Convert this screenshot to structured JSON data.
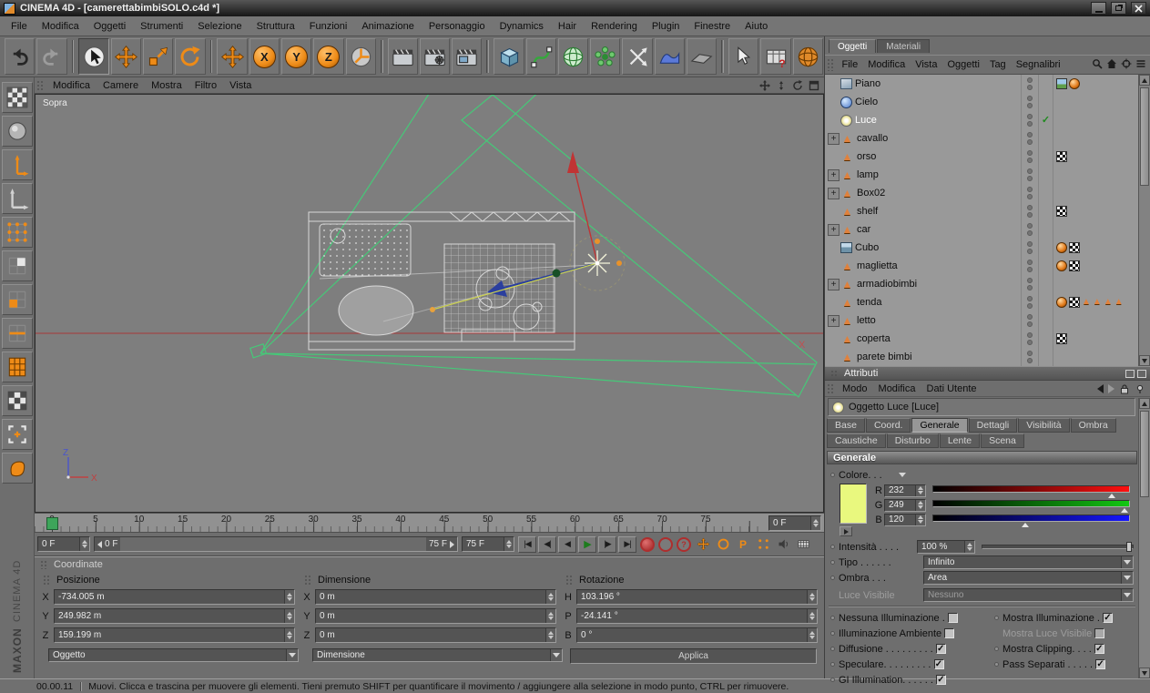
{
  "window": {
    "title": "CINEMA 4D - [camerettabimbiSOLO.c4d *]"
  },
  "menubar": {
    "items": [
      "File",
      "Modifica",
      "Oggetti",
      "Strumenti",
      "Selezione",
      "Struttura",
      "Funzioni",
      "Animazione",
      "Personaggio",
      "Dynamics",
      "Hair",
      "Rendering",
      "Plugin",
      "Finestre",
      "Aiuto"
    ]
  },
  "toolbar": {
    "axis_locks": [
      "X",
      "Y",
      "Z"
    ]
  },
  "icons": {
    "question_mark": "?"
  },
  "viewport": {
    "menu": [
      "Modifica",
      "Camere",
      "Mostra",
      "Filtro",
      "Vista"
    ],
    "view_label": "Sopra",
    "axis_x_label": "X",
    "gizmo": {
      "z": "Z",
      "x": "X"
    }
  },
  "objects_panel": {
    "tabs": [
      {
        "label": "Oggetti",
        "active": true
      },
      {
        "label": "Materiali",
        "active": false
      }
    ],
    "menu": [
      "File",
      "Modifica",
      "Vista",
      "Oggetti",
      "Tag",
      "Segnalibri"
    ],
    "items": [
      {
        "label": "Piano",
        "icon": "plane",
        "tags": [
          "paint",
          "sphere"
        ]
      },
      {
        "label": "Cielo",
        "icon": "sky"
      },
      {
        "label": "Luce",
        "icon": "light",
        "selected": true,
        "check": true
      },
      {
        "label": "cavallo",
        "icon": "triangle",
        "expandable": true
      },
      {
        "label": "orso",
        "icon": "triangle",
        "tags": [
          "checker"
        ]
      },
      {
        "label": "lamp",
        "icon": "triangle",
        "expandable": true
      },
      {
        "label": "Box02",
        "icon": "triangle",
        "expandable": true
      },
      {
        "label": "shelf",
        "icon": "triangle",
        "tags": [
          "checker"
        ]
      },
      {
        "label": "car",
        "icon": "triangle",
        "expandable": true
      },
      {
        "label": "Cubo",
        "icon": "cube",
        "tags": [
          "sphere",
          "checker"
        ]
      },
      {
        "label": "maglietta",
        "icon": "triangle",
        "tags": [
          "sphere",
          "checker"
        ]
      },
      {
        "label": "armadiobimbi",
        "icon": "triangle",
        "expandable": true
      },
      {
        "label": "tenda",
        "icon": "triangle",
        "tags": [
          "sphere",
          "checker",
          "tri",
          "tri",
          "tri",
          "tri"
        ]
      },
      {
        "label": "letto",
        "icon": "triangle",
        "expandable": true
      },
      {
        "label": "coperta",
        "icon": "triangle",
        "tags": [
          "checker"
        ]
      },
      {
        "label": "parete bimbi",
        "icon": "triangle"
      }
    ]
  },
  "attributes_panel": {
    "header": "Attributi",
    "menu": [
      "Modo",
      "Modifica",
      "Dati Utente"
    ],
    "object_title": "Oggetto Luce [Luce]",
    "tabs_row1": [
      "Base",
      "Coord.",
      "Generale",
      "Dettagli",
      "Visibilità",
      "Ombra"
    ],
    "tabs_row2": [
      "Caustiche",
      "Disturbo",
      "Lente",
      "Scena"
    ],
    "active_tab": "Generale",
    "section_title": "Generale",
    "color": {
      "label": "Colore. . .",
      "swatch": "#e9f87e",
      "channels": [
        {
          "label": "R",
          "value": "232",
          "max": 255,
          "color": "#ff1010"
        },
        {
          "label": "G",
          "value": "249",
          "max": 255,
          "color": "#12c812"
        },
        {
          "label": "B",
          "value": "120",
          "max": 255,
          "color": "#1515ff"
        }
      ]
    },
    "intensity": {
      "label": "Intensità . . . .",
      "value": "100 %"
    },
    "tipo": {
      "label": "Tipo . . . . . .",
      "value": "Infinito"
    },
    "ombra": {
      "label": "Ombra . . .",
      "value": "Area"
    },
    "luce_visibile": {
      "label": "Luce Visibile",
      "value": "Nessuno"
    },
    "options_rows": [
      {
        "left": {
          "label": "Nessuna Illuminazione .",
          "checked": false,
          "anim": true
        },
        "right": {
          "label": "Mostra Illuminazione .",
          "checked": true,
          "anim": true
        }
      },
      {
        "left": {
          "label": "Illuminazione Ambiente",
          "checked": false,
          "anim": true
        },
        "right": {
          "label": "Mostra Luce Visibile",
          "checked": false,
          "anim": false,
          "disabled": true
        }
      },
      {
        "left": {
          "label": "Diffusione . . . . . . . . .",
          "checked": true,
          "anim": true
        },
        "right": {
          "label": "Mostra Clipping. . . .",
          "checked": true,
          "anim": true
        }
      },
      {
        "left": {
          "label": "Speculare. . . . . . . . .",
          "checked": true,
          "anim": true
        },
        "right": {
          "label": "Pass Separati . . . . .",
          "checked": true,
          "anim": true
        }
      },
      {
        "left": {
          "label": "GI Illumination. . . . . .",
          "checked": true,
          "anim": true
        },
        "right": null
      }
    ]
  },
  "timeline": {
    "ticks": [
      "0",
      "5",
      "10",
      "15",
      "20",
      "25",
      "30",
      "35",
      "40",
      "45",
      "50",
      "55",
      "60",
      "65",
      "70",
      "75"
    ],
    "frame_field": "0 F",
    "current_frame_field": "0 F",
    "range_start": "0 F",
    "range_end": "75 F",
    "end_field": "75 F",
    "transport": [
      {
        "name": "goto-start",
        "glyph": "|◀"
      },
      {
        "name": "prev-key",
        "glyph": "◀|"
      },
      {
        "name": "prev-frame",
        "glyph": "◀"
      },
      {
        "name": "play",
        "glyph": "▶"
      },
      {
        "name": "next-frame",
        "glyph": "|▶"
      },
      {
        "name": "goto-end",
        "glyph": "▶|"
      }
    ],
    "record_parameter_label": "P"
  },
  "coordinates": {
    "panel_title": "Coordinate",
    "groups": [
      {
        "title": "Posizione",
        "rows": [
          {
            "axis": "X",
            "value": "-734.005 m"
          },
          {
            "axis": "Y",
            "value": "249.982 m"
          },
          {
            "axis": "Z",
            "value": "159.199 m"
          }
        ]
      },
      {
        "title": "Dimensione",
        "rows": [
          {
            "axis": "X",
            "value": "0 m"
          },
          {
            "axis": "Y",
            "value": "0 m"
          },
          {
            "axis": "Z",
            "value": "0 m"
          }
        ]
      },
      {
        "title": "Rotazione",
        "rows": [
          {
            "axis": "H",
            "value": "103.196 °"
          },
          {
            "axis": "P",
            "value": "-24.141 °"
          },
          {
            "axis": "B",
            "value": "0 °"
          }
        ]
      }
    ],
    "dropdown_left": "Oggetto",
    "dropdown_mid": "Dimensione",
    "apply_button": "Applica"
  },
  "statusbar": {
    "time": "00.00.11",
    "message": "Muovi. Clicca e trascina per muovere gli elementi. Tieni premuto SHIFT per quantificare il movimento / aggiungere alla selezione in modo punto, CTRL per rimuovere."
  },
  "branding": {
    "line1": "MAXON",
    "line2": "CINEMA 4D"
  }
}
